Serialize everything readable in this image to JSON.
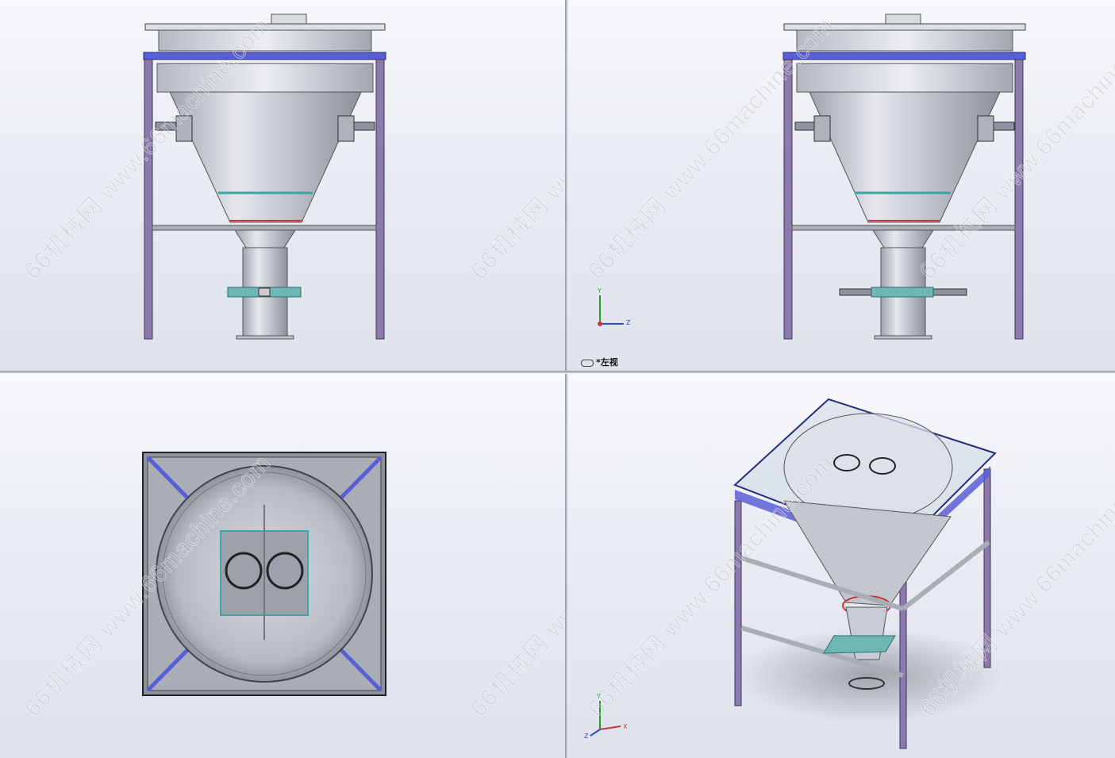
{
  "watermark": {
    "text": "66机械网 www.66machine.com"
  },
  "viewports": [
    {
      "id": "front",
      "label": ""
    },
    {
      "id": "left",
      "label": "*左视"
    },
    {
      "id": "top",
      "label": ""
    },
    {
      "id": "iso",
      "label": ""
    }
  ],
  "triad": {
    "x": "X",
    "y": "Y",
    "z": "Z"
  },
  "colors": {
    "frame": "#8a73a8",
    "beam": "#4a4fd0",
    "steel": "#c8ccd4",
    "teal": "#3aa6a6",
    "red": "#c23a3a"
  }
}
